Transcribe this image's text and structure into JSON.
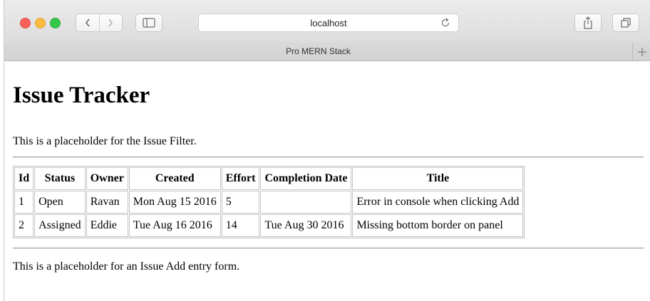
{
  "browser": {
    "address": "localhost",
    "tab_title": "Pro MERN Stack",
    "colors": {
      "close": "#fc605b",
      "minimize": "#fdbc40",
      "zoom": "#34c84a"
    },
    "icons": {
      "back": "chevron-left-icon",
      "forward": "chevron-right-icon",
      "sidebar": "sidebar-icon",
      "reload": "reload-icon",
      "share": "share-icon",
      "tabs": "tabs-overview-icon",
      "new_tab": "plus-icon"
    }
  },
  "page": {
    "title": "Issue Tracker",
    "filter_placeholder": "This is a placeholder for the Issue Filter.",
    "add_placeholder": "This is a placeholder for an Issue Add entry form.",
    "table": {
      "headers": [
        "Id",
        "Status",
        "Owner",
        "Created",
        "Effort",
        "Completion Date",
        "Title"
      ],
      "rows": [
        [
          "1",
          "Open",
          "Ravan",
          "Mon Aug 15 2016",
          "5",
          "",
          "Error in console when clicking Add"
        ],
        [
          "2",
          "Assigned",
          "Eddie",
          "Tue Aug 16 2016",
          "14",
          "Tue Aug 30 2016",
          "Missing bottom border on panel"
        ]
      ]
    }
  }
}
